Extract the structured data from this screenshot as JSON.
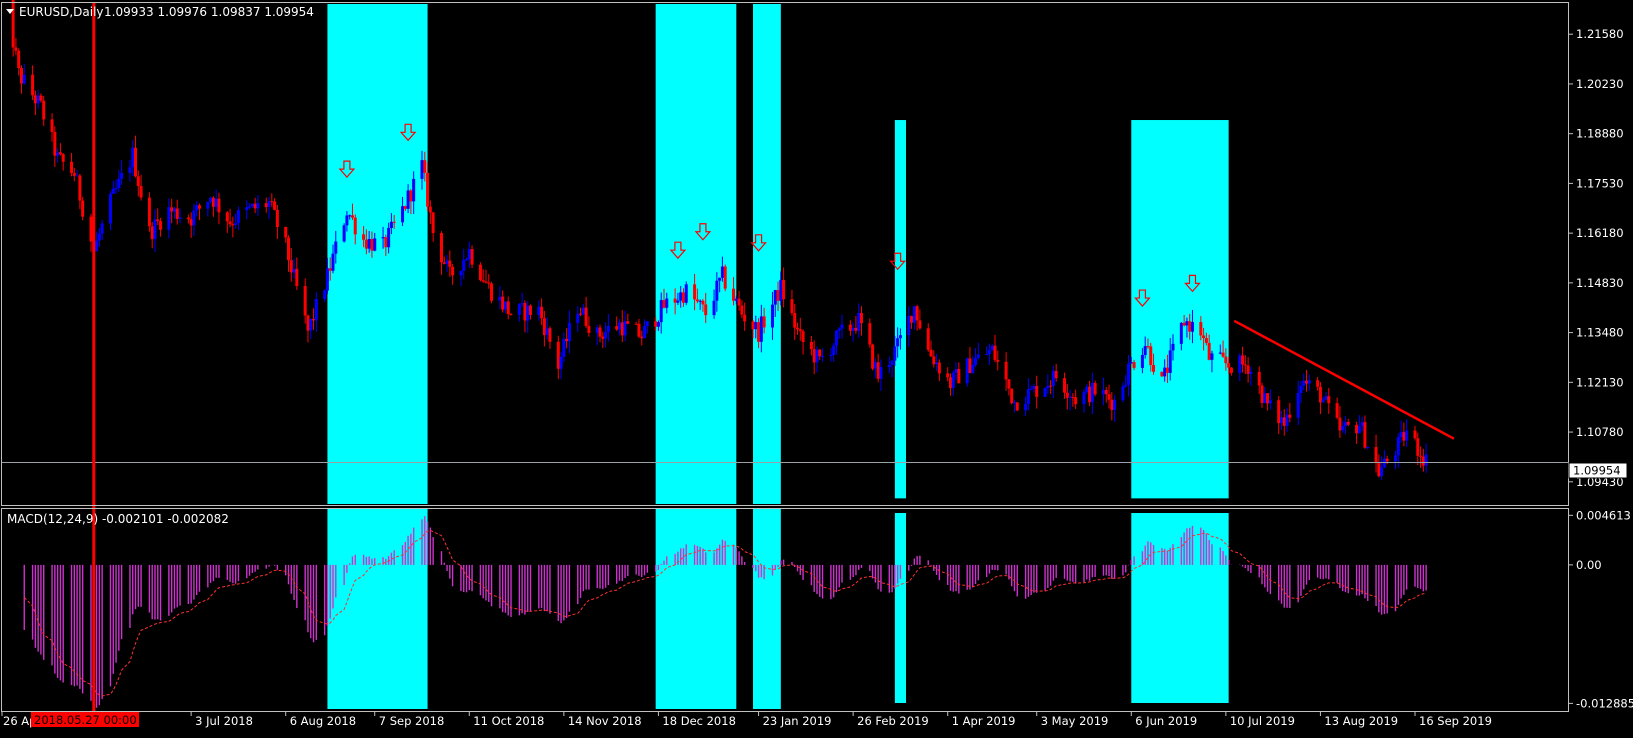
{
  "symbol_header": {
    "symbol": "EURUSD,Daily",
    "ohlc": "1.09933 1.09976 1.09837 1.09954"
  },
  "macd_header": {
    "label": "MACD(12,24,9) -0.002101 -0.002082"
  },
  "price_axis": {
    "ticks": [
      "1.21580",
      "1.20230",
      "1.18880",
      "1.17530",
      "1.16180",
      "1.14830",
      "1.13480",
      "1.12130",
      "1.10780",
      "1.09430"
    ],
    "current_price": "1.09954"
  },
  "macd_axis": {
    "ticks": [
      "0.004613",
      "0.00",
      "-0.012885"
    ]
  },
  "time_axis": {
    "labels": [
      "26 Apr 2018",
      "3 Jul 2018",
      "6 Aug 2018",
      "7 Sep 2018",
      "11 Oct 2018",
      "14 Nov 2018",
      "18 Dec 2018",
      "23 Jan 2019",
      "26 Feb 2019",
      "1 Apr 2019",
      "3 May 2019",
      "6 Jun 2019",
      "10 Jul 2019",
      "13 Aug 2019",
      "16 Sep 2019"
    ],
    "crosshair_label": "2018.05.27 00:00"
  },
  "colors": {
    "background": "#000000",
    "bull_candle": "#0000ff",
    "bear_candle": "#ff0000",
    "highlight": "#00ffff",
    "macd_hist": "#cc33cc",
    "signal_line": "#ff3030",
    "axis_text": "#ffffff",
    "grid_line": "#c0c0c0",
    "crosshair": "#ff0000"
  },
  "chart_data": {
    "type": "candlestick",
    "symbol": "EURUSD",
    "timeframe": "Daily",
    "y_range": [
      1.088,
      1.224
    ],
    "macd_range": [
      -0.0135,
      0.0052
    ],
    "anchors": [
      [
        "2018-04-26",
        1.232
      ],
      [
        "2018-05-02",
        1.205
      ],
      [
        "2018-05-10",
        1.196
      ],
      [
        "2018-05-16",
        1.182
      ],
      [
        "2018-05-22",
        1.178
      ],
      [
        "2018-05-29",
        1.157
      ],
      [
        "2018-06-04",
        1.17
      ],
      [
        "2018-06-12",
        1.183
      ],
      [
        "2018-06-18",
        1.162
      ],
      [
        "2018-06-25",
        1.168
      ],
      [
        "2018-07-03",
        1.166
      ],
      [
        "2018-07-10",
        1.172
      ],
      [
        "2018-07-17",
        1.165
      ],
      [
        "2018-07-24",
        1.168
      ],
      [
        "2018-07-31",
        1.17
      ],
      [
        "2018-08-06",
        1.158
      ],
      [
        "2018-08-14",
        1.135
      ],
      [
        "2018-08-21",
        1.15
      ],
      [
        "2018-08-28",
        1.168
      ],
      [
        "2018-09-03",
        1.16
      ],
      [
        "2018-09-10",
        1.158
      ],
      [
        "2018-09-17",
        1.168
      ],
      [
        "2018-09-24",
        1.18
      ],
      [
        "2018-09-28",
        1.162
      ],
      [
        "2018-10-04",
        1.15
      ],
      [
        "2018-10-11",
        1.157
      ],
      [
        "2018-10-18",
        1.147
      ],
      [
        "2018-10-26",
        1.14
      ],
      [
        "2018-11-05",
        1.141
      ],
      [
        "2018-11-12",
        1.126
      ],
      [
        "2018-11-19",
        1.142
      ],
      [
        "2018-11-26",
        1.134
      ],
      [
        "2018-12-04",
        1.137
      ],
      [
        "2018-12-12",
        1.134
      ],
      [
        "2018-12-20",
        1.142
      ],
      [
        "2018-12-28",
        1.146
      ],
      [
        "2019-01-04",
        1.14
      ],
      [
        "2019-01-10",
        1.15
      ],
      [
        "2019-01-17",
        1.14
      ],
      [
        "2019-01-23",
        1.135
      ],
      [
        "2019-01-31",
        1.147
      ],
      [
        "2019-02-07",
        1.133
      ],
      [
        "2019-02-14",
        1.127
      ],
      [
        "2019-02-21",
        1.134
      ],
      [
        "2019-02-28",
        1.138
      ],
      [
        "2019-03-07",
        1.123
      ],
      [
        "2019-03-14",
        1.131
      ],
      [
        "2019-03-20",
        1.142
      ],
      [
        "2019-03-25",
        1.13
      ],
      [
        "2019-04-02",
        1.121
      ],
      [
        "2019-04-10",
        1.127
      ],
      [
        "2019-04-17",
        1.13
      ],
      [
        "2019-04-25",
        1.116
      ],
      [
        "2019-05-02",
        1.119
      ],
      [
        "2019-05-10",
        1.123
      ],
      [
        "2019-05-17",
        1.117
      ],
      [
        "2019-05-24",
        1.119
      ],
      [
        "2019-05-31",
        1.116
      ],
      [
        "2019-06-05",
        1.125
      ],
      [
        "2019-06-11",
        1.132
      ],
      [
        "2019-06-17",
        1.121
      ],
      [
        "2019-06-25",
        1.138
      ],
      [
        "2019-07-01",
        1.135
      ],
      [
        "2019-07-04",
        1.128
      ],
      [
        "2019-07-11",
        1.126
      ],
      [
        "2019-07-18",
        1.126
      ],
      [
        "2019-07-25",
        1.115
      ],
      [
        "2019-07-31",
        1.11
      ],
      [
        "2019-08-06",
        1.122
      ],
      [
        "2019-08-13",
        1.118
      ],
      [
        "2019-08-20",
        1.108
      ],
      [
        "2019-08-27",
        1.11
      ],
      [
        "2019-09-03",
        1.097
      ],
      [
        "2019-09-10",
        1.104
      ],
      [
        "2019-09-13",
        1.108
      ],
      [
        "2019-09-20",
        1.1
      ]
    ],
    "highlight_zones": [
      [
        "2018-08-21",
        "2018-09-26",
        "full"
      ],
      [
        "2018-12-17",
        "2019-01-15",
        "full"
      ],
      [
        "2019-01-21",
        "2019-01-31",
        "full"
      ],
      [
        "2019-03-13",
        "2019-03-17",
        "partial"
      ],
      [
        "2019-06-06",
        "2019-07-11",
        "partial"
      ]
    ],
    "arrow_markers": [
      [
        "2018-08-28",
        1.177
      ],
      [
        "2018-09-19",
        1.187
      ],
      [
        "2018-12-25",
        1.155
      ],
      [
        "2019-01-03",
        1.16
      ],
      [
        "2019-01-23",
        1.157
      ],
      [
        "2019-03-14",
        1.152
      ],
      [
        "2019-06-10",
        1.142
      ],
      [
        "2019-06-28",
        1.146
      ]
    ],
    "trendline": [
      [
        "2019-07-13",
        1.138
      ],
      [
        "2019-09-30",
        1.106
      ]
    ],
    "current_price_line": 1.09954,
    "crosshair_date": "2018-05-29"
  }
}
